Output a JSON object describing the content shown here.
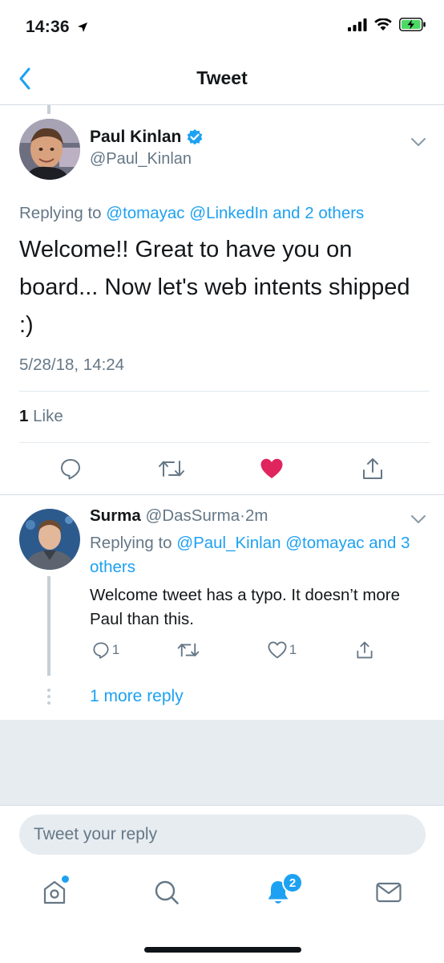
{
  "status_bar": {
    "time": "14:36"
  },
  "nav": {
    "title": "Tweet"
  },
  "main_tweet": {
    "author_name": "Paul Kinlan",
    "author_handle": "@Paul_Kinlan",
    "replying_prefix": "Replying to",
    "replying_mention_1": "@tomayac",
    "replying_mention_2": "@LinkedIn",
    "replying_and": "and",
    "replying_others": "2 others",
    "text": "Welcome!! Great to have you on board... Now let's web intents shipped :)",
    "timestamp": "5/28/18, 14:24",
    "like_count": "1",
    "like_label": "Like"
  },
  "reply_tweet": {
    "author_name": "Surma",
    "author_handle": "@DasSurma",
    "separator": "·",
    "time_ago": "2m",
    "replying_prefix": "Replying to",
    "replying_mention_1": "@Paul_Kinlan",
    "replying_mention_2": "@tomayac",
    "replying_others": "and 3 others",
    "text": "Welcome tweet has a typo. It doesn’t more Paul than this.",
    "reply_count": "1",
    "like_count": "1",
    "more_replies": "1 more reply"
  },
  "compose": {
    "placeholder": "Tweet your reply"
  },
  "tab_bar": {
    "notifications_badge": "2"
  },
  "colors": {
    "accent": "#1da1f2",
    "like": "#e0245e",
    "secondary_text": "#657786",
    "verified": "#1da1f2"
  }
}
